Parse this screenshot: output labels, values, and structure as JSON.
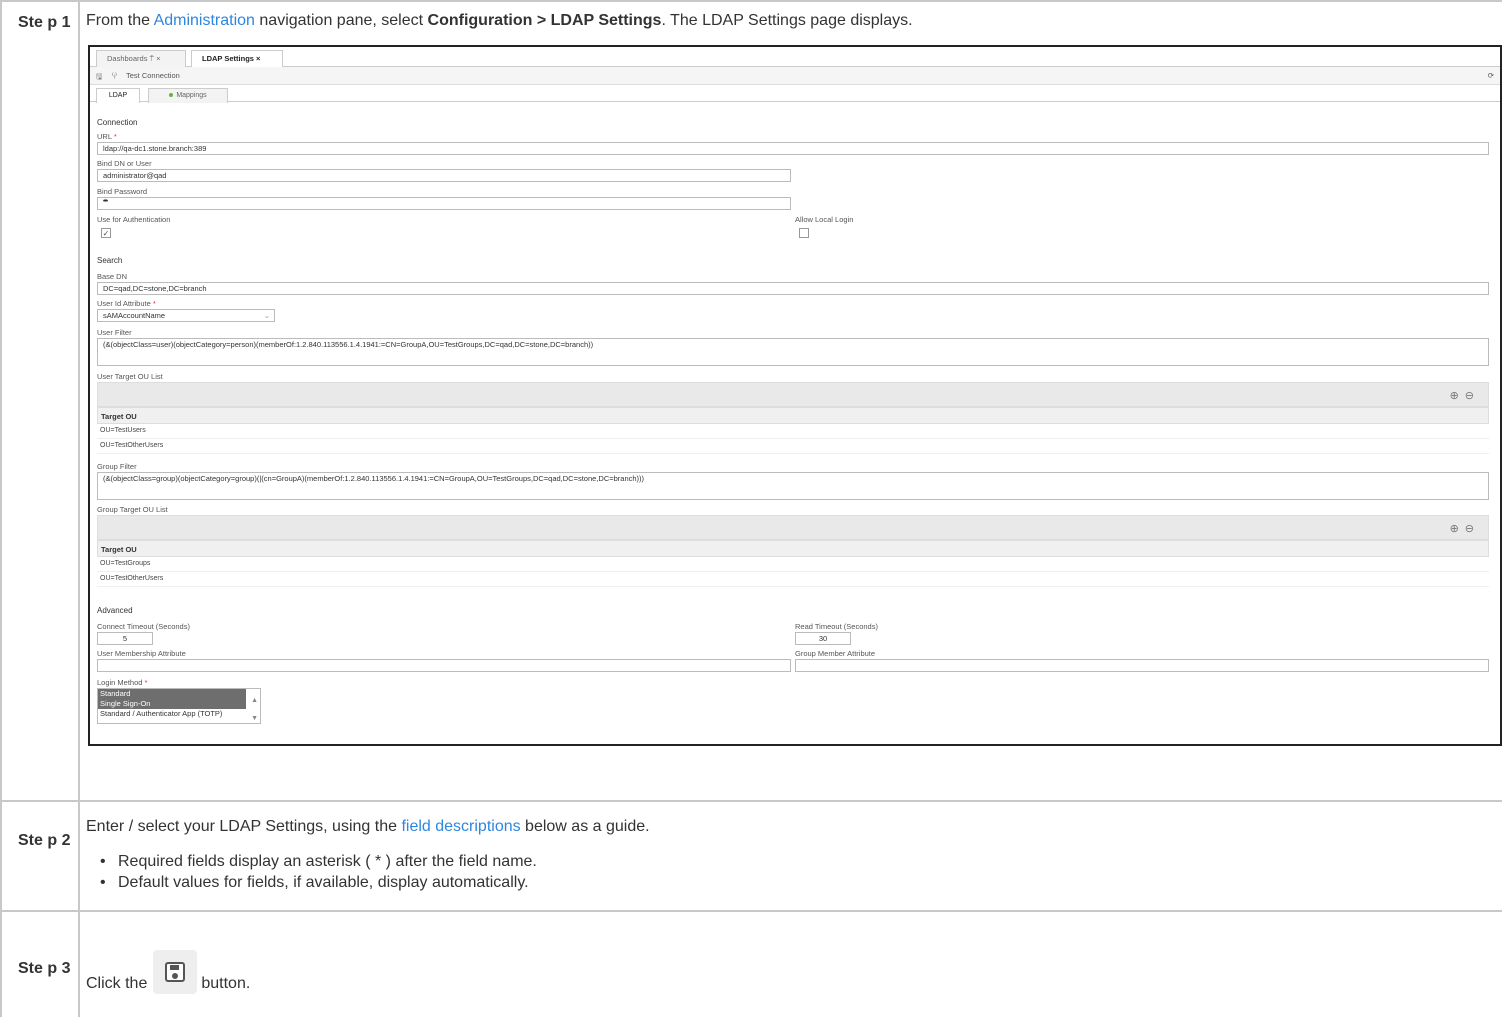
{
  "steps": [
    {
      "label": "Ste p 1",
      "text_prefix": "From the ",
      "link": "Administration",
      "text_mid": " navigation pane, select ",
      "bold": "Configuration > LDAP Settings",
      "text_suffix": ". The LDAP Settings page displays."
    },
    {
      "label": "Ste p 2",
      "text_prefix": "Enter / select your LDAP Settings, using the ",
      "link": "field descriptions",
      "text_suffix": " below as a guide.",
      "bullets": [
        "Required fields display an asterisk ( * ) after the field name.",
        "Default values for fields, if available, display automatically."
      ]
    },
    {
      "label": "Ste p 3",
      "text_prefix": "Click the",
      "text_suffix": "button."
    }
  ],
  "screenshot": {
    "tabs": [
      {
        "label": "Dashboards ⍑ ×"
      },
      {
        "label": "LDAP Settings ×"
      }
    ],
    "toolbar": {
      "test_connection": "Test Connection"
    },
    "subtabs": [
      "LDAP",
      "Mappings"
    ],
    "connection": {
      "heading": "Connection",
      "url_label": "URL",
      "url_value": "ldap://qa-dc1.stone.branch:389",
      "bind_dn_label": "Bind DN or User",
      "bind_dn_value": "administrator@qad",
      "bind_pw_label": "Bind Password",
      "bind_pw_value": "••••••••••••••••••••••••••••••",
      "use_auth_label": "Use for Authentication",
      "allow_local_label": "Allow Local Login"
    },
    "search": {
      "heading": "Search",
      "base_dn_label": "Base DN",
      "base_dn_value": "DC=qad,DC=stone,DC=branch",
      "user_id_label": "User Id Attribute",
      "user_id_value": "sAMAccountName",
      "user_filter_label": "User Filter",
      "user_filter_value": "(&(objectClass=user)(objectCategory=person)(memberOf:1.2.840.113556.1.4.1941:=CN=GroupA,OU=TestGroups,DC=qad,DC=stone,DC=branch))",
      "user_ou_label": "User Target OU List",
      "target_ou_header": "Target OU",
      "user_ou_rows": [
        "OU=TestUsers",
        "OU=TestOtherUsers"
      ],
      "group_filter_label": "Group Filter",
      "group_filter_value": "(&(objectClass=group)(objectCategory=group)(|(cn=GroupA)(memberOf:1.2.840.113556.1.4.1941:=CN=GroupA,OU=TestGroups,DC=qad,DC=stone,DC=branch)))",
      "group_ou_label": "Group Target OU List",
      "group_ou_rows": [
        "OU=TestGroups",
        "OU=TestOtherUsers"
      ]
    },
    "advanced": {
      "heading": "Advanced",
      "connect_timeout_label": "Connect Timeout (Seconds)",
      "connect_timeout_value": "5",
      "read_timeout_label": "Read Timeout (Seconds)",
      "read_timeout_value": "30",
      "user_membership_label": "User Membership Attribute",
      "group_member_label": "Group Member Attribute",
      "login_method_label": "Login Method",
      "login_methods": [
        "Standard",
        "Single Sign-On",
        "Standard / Authenticator App (TOTP)"
      ]
    }
  }
}
